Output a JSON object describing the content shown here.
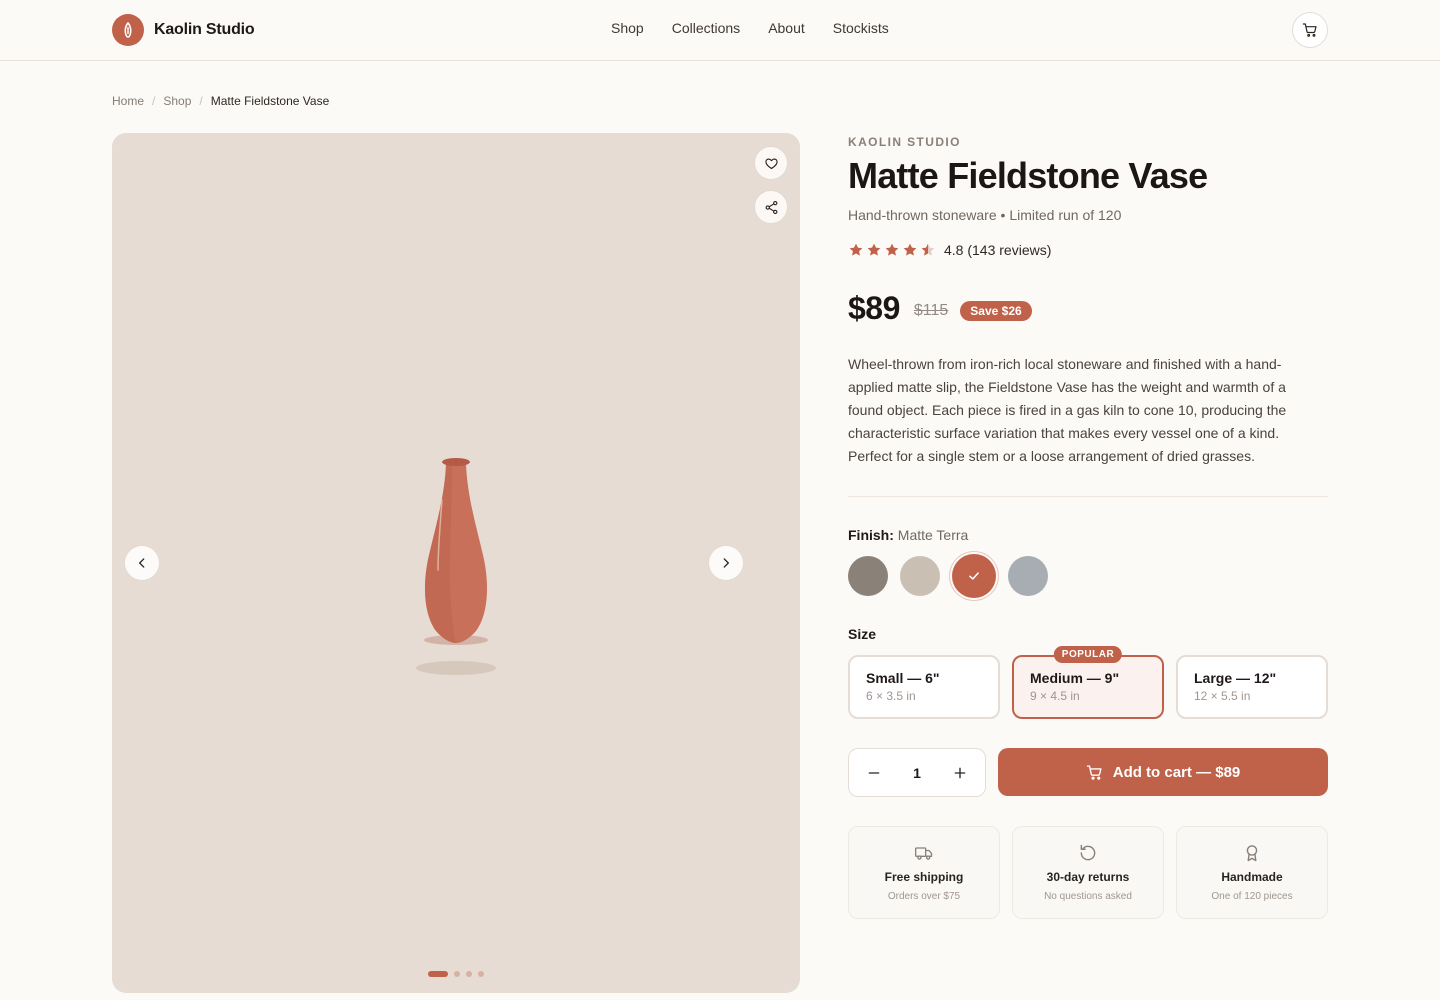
{
  "brand": {
    "name": "Kaolin Studio"
  },
  "nav": {
    "items": [
      "Shop",
      "Collections",
      "About",
      "Stockists"
    ]
  },
  "breadcrumb": {
    "home": "Home",
    "shop": "Shop",
    "current": "Matte Fieldstone Vase"
  },
  "gallery": {
    "slides": 4,
    "active_slide": 1
  },
  "product": {
    "eyebrow": "KAOLIN STUDIO",
    "title": "Matte Fieldstone Vase",
    "subtitle": "Hand-thrown stoneware • Limited run of 120",
    "rating": 4.8,
    "rating_text": "4.8 (143 reviews)",
    "price": "$89",
    "old_price": "$115",
    "save_badge": "Save $26",
    "description": "Wheel-thrown from iron-rich local stoneware and finished with a hand-applied matte slip, the Fieldstone Vase has the weight and warmth of a found object. Each piece is fired in a gas kiln to cone 10, producing the characteristic surface variation that makes every vessel one of a kind. Perfect for a single stem or a loose arrangement of dried grasses."
  },
  "finish": {
    "label": "Finish:",
    "selected": "Matte Terra",
    "swatches": [
      "#8a8178",
      "#c9bfb2",
      "#c0614a",
      "#a7adb3"
    ]
  },
  "size": {
    "label": "Size",
    "options": [
      {
        "name": "Small — 6\"",
        "dims": "6 × 3.5 in"
      },
      {
        "name": "Medium — 9\"",
        "dims": "9 × 4.5 in",
        "badge": "POPULAR"
      },
      {
        "name": "Large — 12\"",
        "dims": "12 × 5.5 in"
      }
    ]
  },
  "cart": {
    "quantity": "1",
    "add_label": "Add to cart — $89"
  },
  "perks": [
    {
      "icon": "truck-icon",
      "title": "Free shipping",
      "sub": "Orders over $75"
    },
    {
      "icon": "returns-icon",
      "title": "30-day returns",
      "sub": "No questions asked"
    },
    {
      "icon": "award-icon",
      "title": "Handmade",
      "sub": "One of 120 pieces"
    }
  ],
  "colors": {
    "accent": "#c0614a",
    "background": "#fcfaf7",
    "gallery_bg": "#e6dcd3"
  }
}
